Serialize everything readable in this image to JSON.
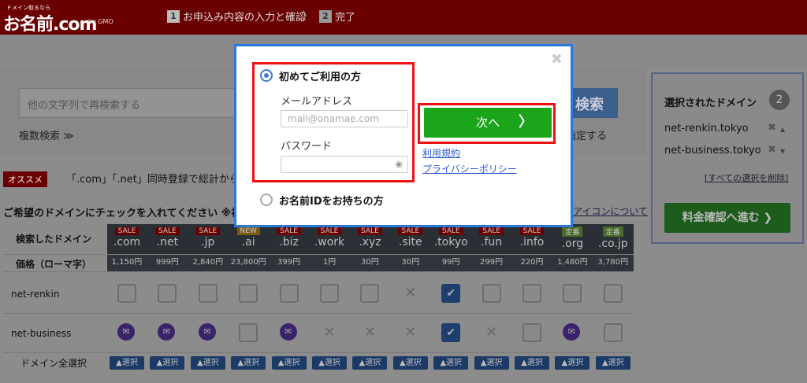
{
  "header": {
    "logo_small": "ドメイン取るなら",
    "logo": "お名前.com",
    "logo_sub": "by GMO",
    "step1_num": "1",
    "step1_label": "お申込み内容の入力と確認",
    "step2_num": "2",
    "step2_label": "完了"
  },
  "search": {
    "placeholder": "他の文字列で再検索する",
    "multi_label": "複数検索 ≫",
    "button_label": "検索",
    "specify_label": "指定する"
  },
  "promo": {
    "badge": "オススメ",
    "text": "「.com」「.net」同時登録で総計から"
  },
  "table_heading": "ご希望のドメインにチェックを入れてください ※初",
  "icon_about": "アイコンについて",
  "table": {
    "row_header": "検索したドメイン",
    "price_header": "価格（ローマ字）",
    "select_all": "ドメイン全選択",
    "select_label": "▲選択",
    "tlds": [
      {
        "badge": "SALE",
        "tld": ".com",
        "price": "1,150円",
        "badge_color": "#6b0000"
      },
      {
        "badge": "SALE",
        "tld": ".net",
        "price": "999円",
        "badge_color": "#6b0000"
      },
      {
        "badge": "SALE",
        "tld": ".jp",
        "price": "2,840円",
        "badge_color": "#6b0000"
      },
      {
        "badge": "NEW",
        "tld": ".ai",
        "price": "23,800円",
        "badge_color": "#7a5a10"
      },
      {
        "badge": "SALE",
        "tld": ".biz",
        "price": "399円",
        "badge_color": "#6b0000"
      },
      {
        "badge": "SALE",
        "tld": ".work",
        "price": "1円",
        "badge_color": "#6b0000"
      },
      {
        "badge": "SALE",
        "tld": ".xyz",
        "price": "30円",
        "badge_color": "#6b0000"
      },
      {
        "badge": "SALE",
        "tld": ".site",
        "price": "30円",
        "badge_color": "#6b0000"
      },
      {
        "badge": "SALE",
        "tld": ".tokyo",
        "price": "99円",
        "badge_color": "#6b0000"
      },
      {
        "badge": "SALE",
        "tld": ".fun",
        "price": "299円",
        "badge_color": "#6b0000"
      },
      {
        "badge": "SALE",
        "tld": ".info",
        "price": "220円",
        "badge_color": "#6b0000"
      },
      {
        "badge": "定番",
        "tld": ".org",
        "price": "1,480円",
        "badge_color": "#4a6a2a"
      },
      {
        "badge": "定番",
        "tld": ".co.jp",
        "price": "3,780円",
        "badge_color": "#4a6a2a"
      }
    ],
    "rows": [
      {
        "name": "net-renkin",
        "cells": [
          "box",
          "box",
          "box",
          "box",
          "box",
          "box",
          "box",
          "x",
          "checked",
          "box",
          "box",
          "box",
          "box"
        ]
      },
      {
        "name": "net-business",
        "cells": [
          "mail",
          "mail",
          "mail",
          "box",
          "mail",
          "x",
          "x",
          "x",
          "checked",
          "x",
          "box",
          "mail",
          "box"
        ]
      }
    ]
  },
  "right_panel": {
    "title": "選択されたドメイン",
    "count": "2",
    "domains": [
      "net-renkin.tokyo",
      "net-business.tokyo"
    ],
    "clear_all": "[すべての選択を削除]",
    "proceed": "料金確認へ進む ❯"
  },
  "modal": {
    "option1": "初めてご利用の方",
    "email_label": "メールアドレス",
    "email_placeholder": "mail@onamae.com",
    "password_label": "パスワード",
    "option2": "お名前IDをお持ちの方",
    "next": "次へ",
    "terms": "利用規約",
    "privacy": "プライバシーポリシー",
    "close": "✖"
  }
}
